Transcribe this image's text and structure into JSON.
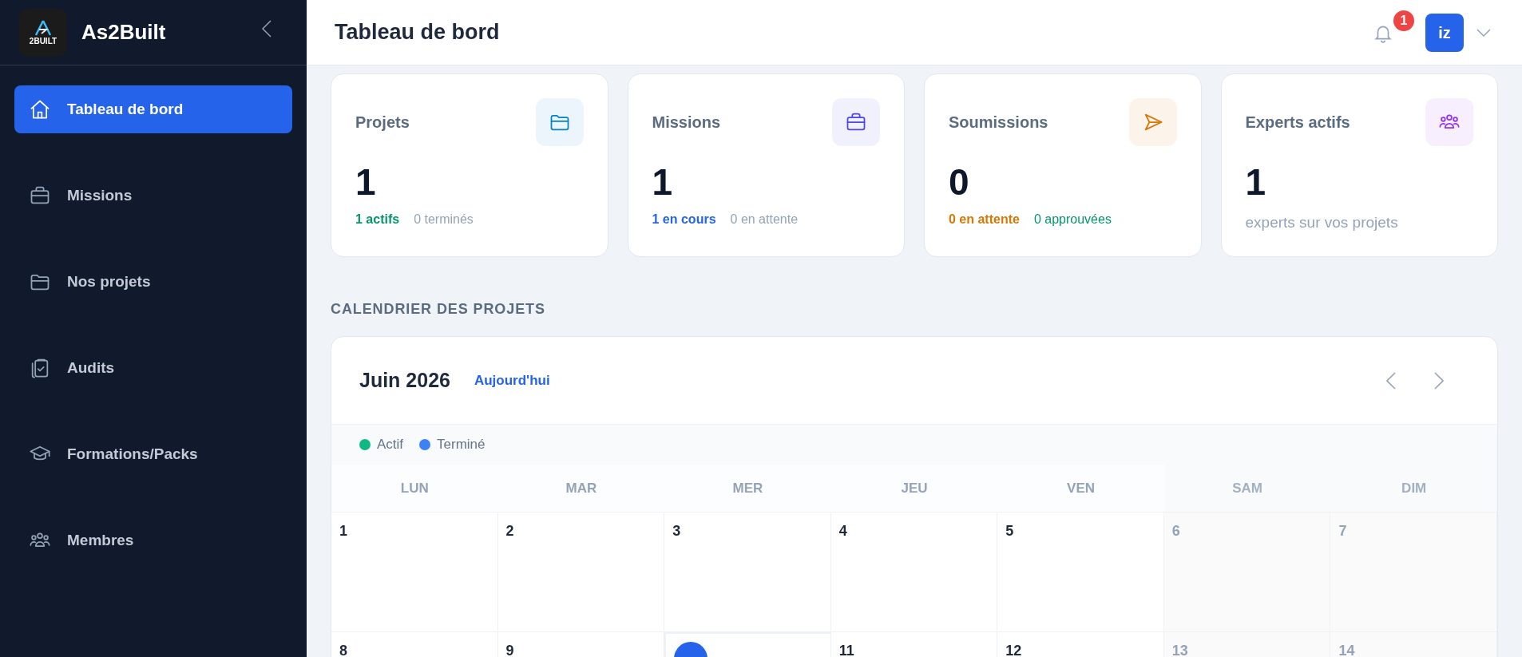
{
  "sidebar": {
    "brand": "As2Built",
    "logo_text": "2BUILT",
    "items": [
      {
        "label": "Tableau de bord",
        "selected": true
      },
      {
        "label": "Missions",
        "selected": false
      },
      {
        "label": "Nos projets",
        "selected": false
      },
      {
        "label": "Audits",
        "selected": false
      },
      {
        "label": "Formations/Packs",
        "selected": false
      },
      {
        "label": "Membres",
        "selected": false
      }
    ]
  },
  "header": {
    "title": "Tableau de bord",
    "notification_count": "1",
    "avatar": "iz"
  },
  "stats": [
    {
      "label": "Projets",
      "color": "#0284c7",
      "value": "1",
      "details": [
        {
          "text": "1 actifs",
          "color": "#059669",
          "strong": true
        },
        {
          "text": "0 terminés",
          "color": "#94a3b8",
          "strong": false
        }
      ]
    },
    {
      "label": "Missions",
      "color": "#4f46e5",
      "value": "1",
      "details": [
        {
          "text": "1 en cours",
          "color": "#2563eb",
          "strong": true
        },
        {
          "text": "0 en attente",
          "color": "#94a3b8",
          "strong": false
        }
      ]
    },
    {
      "label": "Soumissions",
      "color": "#d97706",
      "value": "0",
      "details": [
        {
          "text": "0 en attente",
          "color": "#d97706",
          "strong": true
        },
        {
          "text": "0 approuvées",
          "color": "#059669",
          "strong": false
        }
      ]
    },
    {
      "label": "Experts actifs",
      "color": "#9333ea",
      "value": "1",
      "caption": "experts sur vos projets"
    }
  ],
  "calendar": {
    "section_title": "CALENDRIER DES PROJETS",
    "month": "Juin 2026",
    "today_link": "Aujourd'hui",
    "legend": [
      {
        "label": "Actif",
        "color": "#10b981"
      },
      {
        "label": "Terminé",
        "color": "#3b82f6"
      }
    ],
    "weekdays": [
      {
        "label": "LUN",
        "weekend": false
      },
      {
        "label": "MAR",
        "weekend": false
      },
      {
        "label": "MER",
        "weekend": false
      },
      {
        "label": "JEU",
        "weekend": false
      },
      {
        "label": "VEN",
        "weekend": false
      },
      {
        "label": "SAM",
        "weekend": true
      },
      {
        "label": "DIM",
        "weekend": true
      }
    ],
    "weeks": [
      [
        {
          "day": "1",
          "weekend": false,
          "today": false
        },
        {
          "day": "2",
          "weekend": false,
          "today": false
        },
        {
          "day": "3",
          "weekend": false,
          "today": false
        },
        {
          "day": "4",
          "weekend": false,
          "today": false
        },
        {
          "day": "5",
          "weekend": false,
          "today": false
        },
        {
          "day": "6",
          "weekend": true,
          "today": false
        },
        {
          "day": "7",
          "weekend": true,
          "today": false
        }
      ],
      [
        {
          "day": "8",
          "weekend": false,
          "today": false
        },
        {
          "day": "9",
          "weekend": false,
          "today": false
        },
        {
          "weekend": false,
          "today": true
        },
        {
          "day": "11",
          "weekend": false,
          "today": false
        },
        {
          "day": "12",
          "weekend": false,
          "today": false
        },
        {
          "day": "13",
          "weekend": true,
          "today": false
        },
        {
          "day": "14",
          "weekend": true,
          "today": false
        }
      ]
    ]
  }
}
